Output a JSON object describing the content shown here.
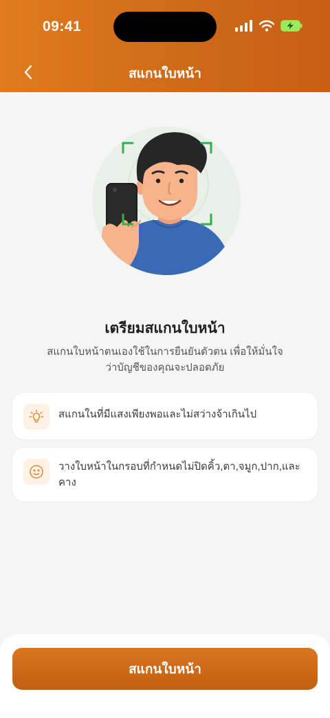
{
  "status_bar": {
    "time": "09:41"
  },
  "header": {
    "title": "สแกนใบหน้า"
  },
  "main": {
    "heading": "เตรียมสแกนใบหน้า",
    "description": "สแกนใบหน้าตนเองใช้ในการยืนยันตัวตน เพื่อให้มั่นใจว่าบัญชีของคุณจะปลอดภัย",
    "tips": [
      {
        "icon": "lightbulb-icon",
        "text": "สแกนในที่มีแสงเพียงพอและไม่สว่างจ้าเกินไป"
      },
      {
        "icon": "smiley-face-icon",
        "text": "วางใบหน้าในกรอบที่กำหนดไม่ปิดคิ้ว,ตา,จมูก,ปาก,และคาง"
      }
    ]
  },
  "footer": {
    "scan_button_label": "สแกนใบหน้า"
  },
  "colors": {
    "brand": "#d56e1a",
    "accent_light": "#fdf1e6",
    "scan_frame": "#2db14a"
  }
}
